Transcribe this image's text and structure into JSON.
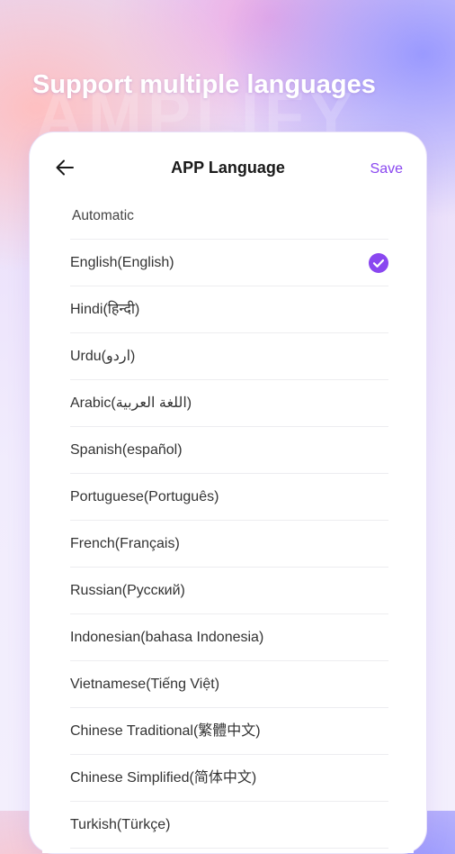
{
  "headline": "Support multiple languages",
  "header": {
    "title": "APP Language",
    "save_label": "Save",
    "back_icon": "arrow-left-icon"
  },
  "accent_color": "#8a47f0",
  "languages": [
    {
      "label": "Automatic",
      "selected": false
    },
    {
      "label": "English(English)",
      "selected": true
    },
    {
      "label": "Hindi(हिन्दी)",
      "selected": false
    },
    {
      "label": "Urdu(اردو)",
      "selected": false
    },
    {
      "label": "Arabic(اللغة العربية)",
      "selected": false
    },
    {
      "label": "Spanish(español)",
      "selected": false
    },
    {
      "label": "Portuguese(Português)",
      "selected": false
    },
    {
      "label": "French(Français)",
      "selected": false
    },
    {
      "label": "Russian(Русский)",
      "selected": false
    },
    {
      "label": "Indonesian(bahasa Indonesia)",
      "selected": false
    },
    {
      "label": "Vietnamese(Tiếng Việt)",
      "selected": false
    },
    {
      "label": "Chinese Traditional(繁體中文)",
      "selected": false
    },
    {
      "label": "Chinese Simplified(简体中文)",
      "selected": false
    },
    {
      "label": "Turkish(Türkçe)",
      "selected": false
    }
  ]
}
